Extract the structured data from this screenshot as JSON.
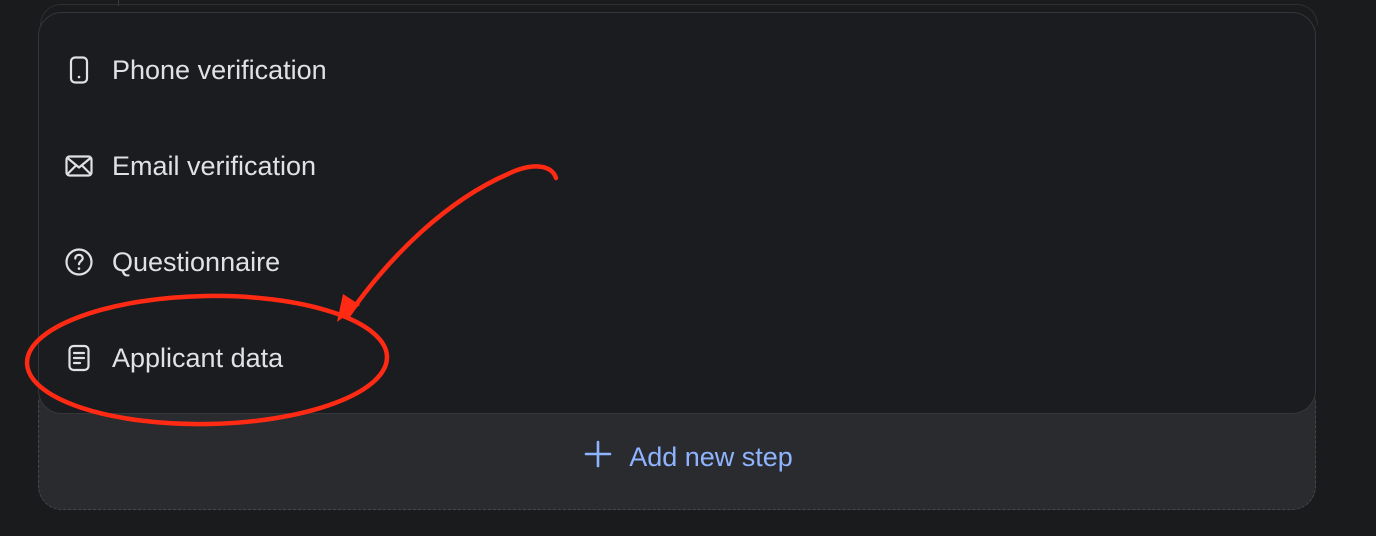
{
  "menu": {
    "items": [
      {
        "label": "Phone verification",
        "icon": "phone-icon"
      },
      {
        "label": "Email verification",
        "icon": "mail-icon"
      },
      {
        "label": "Questionnaire",
        "icon": "question-circle-icon"
      },
      {
        "label": "Applicant data",
        "icon": "document-icon"
      }
    ]
  },
  "add_step": {
    "label": "Add new step",
    "icon": "plus-icon"
  },
  "colors": {
    "background": "#1a1b1d",
    "panel": "#1b1c1f",
    "add_area": "#2a2b2f",
    "accent": "#8fb4ff",
    "annotation": "#ff2a14"
  }
}
